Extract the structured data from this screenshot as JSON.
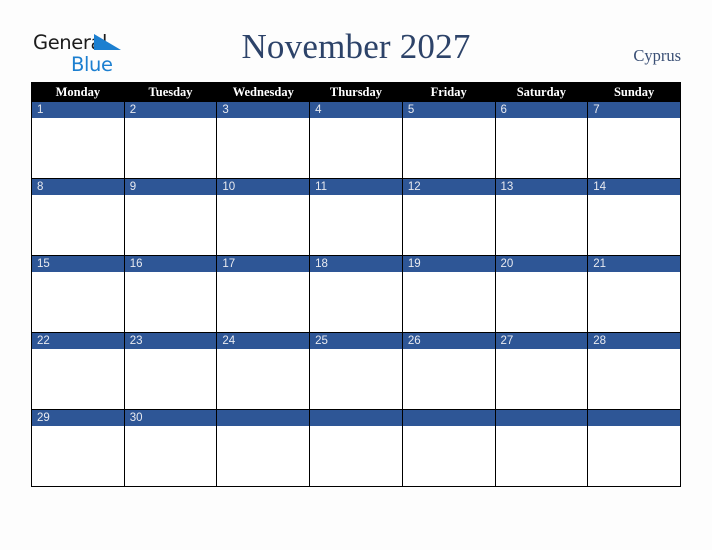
{
  "logo": {
    "word_one": "General",
    "word_two": "Blue",
    "triangle_icon": "triangle-icon",
    "color_dark": "#1c1c1c",
    "color_blue": "#1c7fd0"
  },
  "header": {
    "title": "November 2027",
    "country": "Cyprus",
    "title_color": "#2d4369",
    "country_color": "#3a4f75"
  },
  "calendar": {
    "weekdays": [
      "Monday",
      "Tuesday",
      "Wednesday",
      "Thursday",
      "Friday",
      "Saturday",
      "Sunday"
    ],
    "header_bg": "#000000",
    "header_text": "#ffffff",
    "date_bar_bg": "#2e5696",
    "date_bar_text": "#e8eaf0",
    "cell_bg": "#ffffff",
    "border_color": "#000000",
    "weeks": [
      [
        {
          "date": "1"
        },
        {
          "date": "2"
        },
        {
          "date": "3"
        },
        {
          "date": "4"
        },
        {
          "date": "5"
        },
        {
          "date": "6"
        },
        {
          "date": "7"
        }
      ],
      [
        {
          "date": "8"
        },
        {
          "date": "9"
        },
        {
          "date": "10"
        },
        {
          "date": "11"
        },
        {
          "date": "12"
        },
        {
          "date": "13"
        },
        {
          "date": "14"
        }
      ],
      [
        {
          "date": "15"
        },
        {
          "date": "16"
        },
        {
          "date": "17"
        },
        {
          "date": "18"
        },
        {
          "date": "19"
        },
        {
          "date": "20"
        },
        {
          "date": "21"
        }
      ],
      [
        {
          "date": "22"
        },
        {
          "date": "23"
        },
        {
          "date": "24"
        },
        {
          "date": "25"
        },
        {
          "date": "26"
        },
        {
          "date": "27"
        },
        {
          "date": "28"
        }
      ],
      [
        {
          "date": "29"
        },
        {
          "date": "30"
        },
        {
          "date": ""
        },
        {
          "date": ""
        },
        {
          "date": ""
        },
        {
          "date": ""
        },
        {
          "date": ""
        }
      ]
    ]
  },
  "page": {
    "background": "#fdfdfd"
  }
}
